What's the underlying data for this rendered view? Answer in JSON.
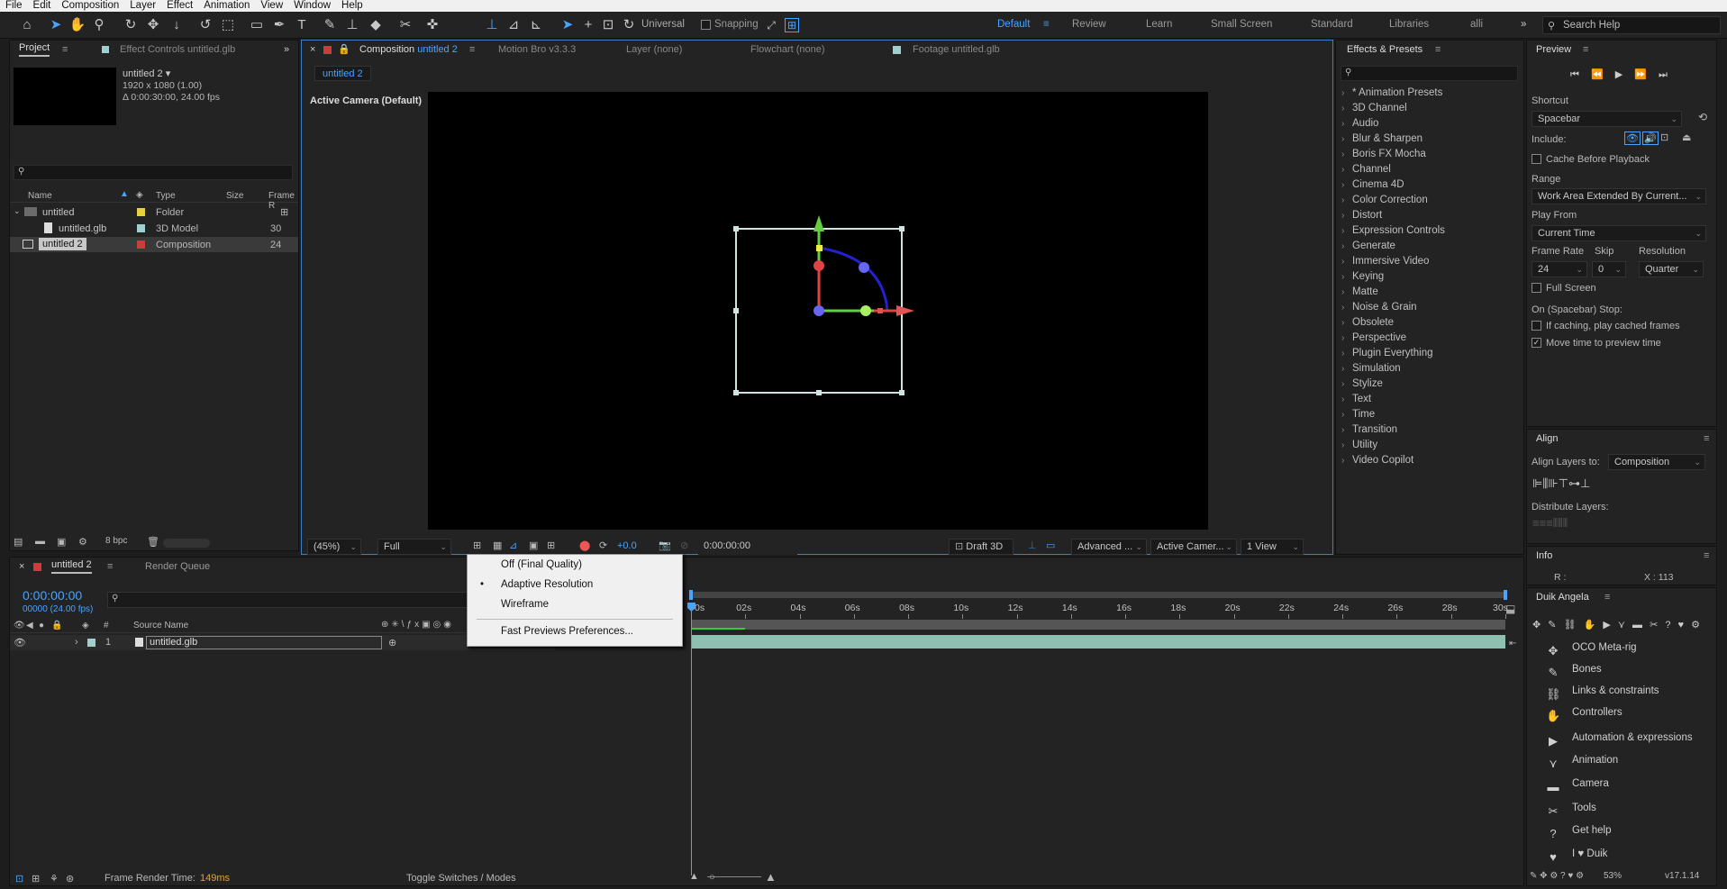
{
  "menu": [
    "File",
    "Edit",
    "Composition",
    "Layer",
    "Effect",
    "Animation",
    "View",
    "Window",
    "Help"
  ],
  "toolbar": {
    "universal": "Universal",
    "snapping": "Snapping",
    "workspaces": [
      "Default",
      "Review",
      "Learn",
      "Small Screen",
      "Standard",
      "Libraries",
      "alli"
    ],
    "search_help": "Search Help"
  },
  "project": {
    "tab": "Project",
    "tab2": "Effect Controls untitled.glb",
    "comp_name": "untitled 2 ▾",
    "comp_res": "1920 x 1080 (1.00)",
    "comp_dur": "Δ 0:00:30:00, 24.00 fps",
    "cols": [
      "Name",
      "Type",
      "Size",
      "Frame R"
    ],
    "rows": [
      {
        "name": "untitled",
        "type": "Folder",
        "size": "",
        "fr": "",
        "color": "#e3d23b"
      },
      {
        "name": "untitled.glb",
        "type": "3D Model",
        "size": "",
        "fr": "30",
        "color": "#9fcfcf"
      },
      {
        "name": "untitled 2",
        "type": "Composition",
        "size": "",
        "fr": "24",
        "color": "#d13a3a"
      }
    ],
    "bpc": "8 bpc"
  },
  "comp": {
    "tab": "Composition",
    "tab_name": "untitled 2",
    "tabs2": [
      "Motion Bro v3.3.3",
      "Layer (none)",
      "Flowchart (none)",
      "Footage untitled.glb"
    ],
    "subtab": "untitled 2",
    "camera": "Active Camera (Default)",
    "zoom": "(45%)",
    "res": "Full",
    "exposure": "+0.0",
    "time": "0:00:00:00",
    "draft": "Draft 3D",
    "renderer": "Advanced ...",
    "camera_dd": "Active Camer...",
    "view": "1 View"
  },
  "effects": {
    "title": "Effects & Presets",
    "items": [
      "* Animation Presets",
      "3D Channel",
      "Audio",
      "Blur & Sharpen",
      "Boris FX Mocha",
      "Channel",
      "Cinema 4D",
      "Color Correction",
      "Distort",
      "Expression Controls",
      "Generate",
      "Immersive Video",
      "Keying",
      "Matte",
      "Noise & Grain",
      "Obsolete",
      "Perspective",
      "Plugin Everything",
      "Simulation",
      "Stylize",
      "Text",
      "Time",
      "Transition",
      "Utility",
      "Video Copilot"
    ]
  },
  "preview": {
    "title": "Preview",
    "shortcut_lbl": "Shortcut",
    "shortcut": "Spacebar",
    "include": "Include:",
    "cache": "Cache Before Playback",
    "range_lbl": "Range",
    "range": "Work Area Extended By Current...",
    "playfrom_lbl": "Play From",
    "playfrom": "Current Time",
    "fr_lbl": "Frame Rate",
    "skip_lbl": "Skip",
    "res_lbl": "Resolution",
    "fr": "24",
    "skip": "0",
    "res": "Quarter",
    "fullscreen": "Full Screen",
    "stop_lbl": "On (Spacebar) Stop:",
    "stop1": "If caching, play cached frames",
    "stop2": "Move time to preview time"
  },
  "align": {
    "title": "Align",
    "layers_to": "Align Layers to:",
    "target": "Composition",
    "distribute": "Distribute Layers:"
  },
  "info": {
    "title": "Info",
    "r": "R :",
    "x": "X : 113"
  },
  "timeline": {
    "tab": "untitled 2",
    "render_queue": "Render Queue",
    "time": "0:00:00:00",
    "fps": "00000 (24.00 fps)",
    "col_src": "Source Name",
    "layer_num": "1",
    "layer_name": "untitled.glb",
    "ruler": [
      "0s",
      "02s",
      "04s",
      "06s",
      "08s",
      "10s",
      "12s",
      "14s",
      "16s",
      "18s",
      "20s",
      "22s",
      "24s",
      "26s",
      "28s",
      "30s"
    ],
    "render_time_lbl": "Frame Render Time:",
    "render_time": "149ms",
    "toggle": "Toggle Switches / Modes"
  },
  "context_menu": {
    "items": [
      "Off (Final Quality)",
      "Adaptive Resolution",
      "Wireframe",
      "Fast Previews Preferences..."
    ],
    "selected": "Adaptive Resolution"
  },
  "duik": {
    "title": "Duik Angela",
    "items": [
      "OCO Meta-rig",
      "Bones",
      "Links & constraints",
      "Controllers",
      "Automation & expressions",
      "Animation",
      "Camera",
      "Tools",
      "Get help",
      "I ♥ Duik"
    ],
    "zoom": "53%",
    "version": "v17.1.14"
  }
}
